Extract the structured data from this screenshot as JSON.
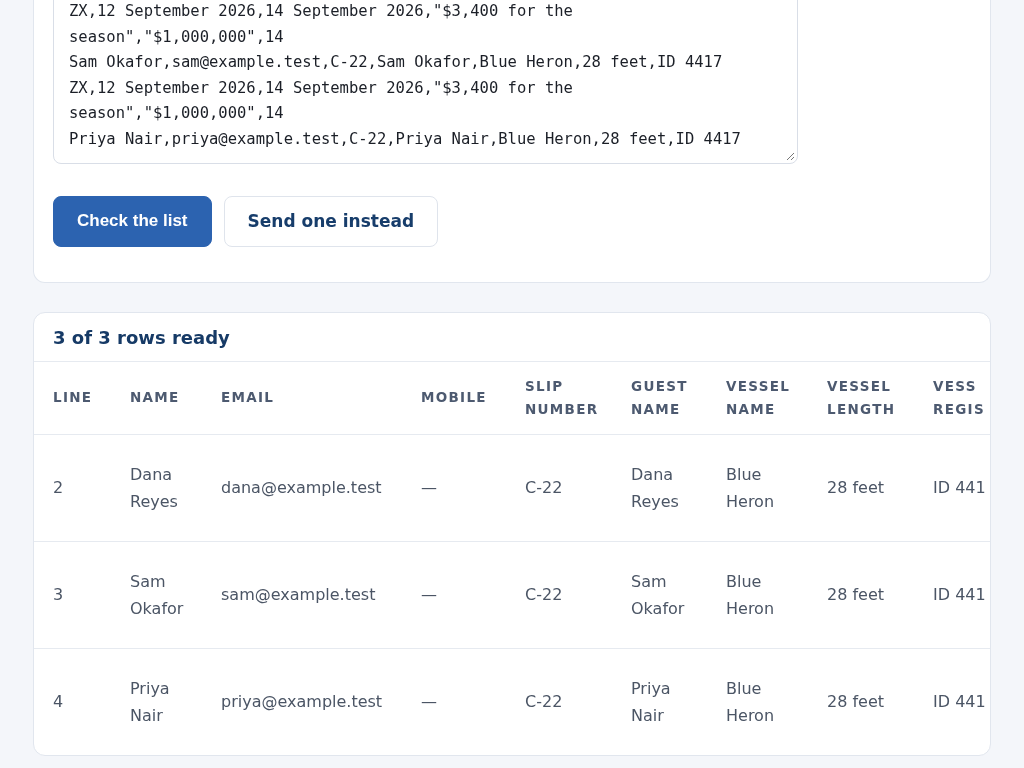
{
  "import_form": {
    "list_value": "ZX,12 September 2026,14 September 2026,\"$3,400 for the\nseason\",\"$1,000,000\",14\nSam Okafor,sam@example.test,C-22,Sam Okafor,Blue Heron,28 feet,ID 4417\nZX,12 September 2026,14 September 2026,\"$3,400 for the\nseason\",\"$1,000,000\",14\nPriya Nair,priya@example.test,C-22,Priya Nair,Blue Heron,28 feet,ID 4417",
    "buttons": [
      {
        "label": "Check the list",
        "kind": "primary"
      },
      {
        "label": "Send one instead",
        "kind": "secondary"
      }
    ]
  },
  "preview": {
    "title": "3 of 3 rows ready",
    "table": {
      "columns": [
        "LINE",
        "NAME",
        "EMAIL",
        "MOBILE",
        "SLIP NUMBER",
        "GUEST NAME",
        "VESSEL NAME",
        "VESSEL LENGTH",
        "VESS REGIS"
      ],
      "rows": [
        [
          "2",
          "Dana Reyes",
          "dana@example.test",
          "—",
          "C-22",
          "Dana Reyes",
          "Blue Heron",
          "28 feet",
          "ID 441"
        ],
        [
          "3",
          "Sam Okafor",
          "sam@example.test",
          "—",
          "C-22",
          "Sam Okafor",
          "Blue Heron",
          "28 feet",
          "ID 441"
        ],
        [
          "4",
          "Priya Nair",
          "priya@example.test",
          "—",
          "C-22",
          "Priya Nair",
          "Blue Heron",
          "28 feet",
          "ID 441"
        ]
      ]
    }
  }
}
